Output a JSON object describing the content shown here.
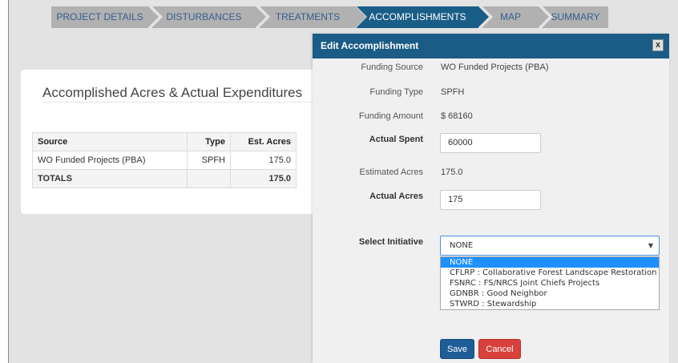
{
  "tabs": [
    {
      "label": "PROJECT DETAILS"
    },
    {
      "label": "DISTURBANCES"
    },
    {
      "label": "TREATMENTS"
    },
    {
      "label": "ACCOMPLISHMENTS"
    },
    {
      "label": "MAP"
    },
    {
      "label": "SUMMARY"
    }
  ],
  "card": {
    "title": "Accomplished Acres & Actual Expenditures",
    "columns": [
      "Source",
      "Type",
      "Est. Acres"
    ],
    "rows": [
      {
        "source": "WO Funded Projects (PBA)",
        "type": "SPFH",
        "est_acres": "175.0"
      }
    ],
    "totals": {
      "label": "TOTALS",
      "est_acres": "175.0"
    }
  },
  "modal": {
    "title": "Edit Accomplishment",
    "close_label": "x",
    "funding_source_label": "Funding Source",
    "funding_source_value": "WO Funded Projects (PBA)",
    "funding_type_label": "Funding Type",
    "funding_type_value": "SPFH",
    "funding_amount_label": "Funding Amount",
    "funding_amount_value": "$ 68160",
    "actual_spent_label": "Actual Spent",
    "actual_spent_value": "60000",
    "estimated_acres_label": "Estimated Acres",
    "estimated_acres_value": "175.0",
    "actual_acres_label": "Actual Acres",
    "actual_acres_value": "175",
    "initiative_label": "Select Initiative",
    "initiative_selected": "NONE",
    "initiative_options": [
      "NONE",
      "CFLRP : Collaborative Forest Landscape Restoration",
      "FSNRC : FS/NRCS Joint Chiefs Projects",
      "GDNBR : Good Neighbor",
      "STWRD : Stewardship"
    ],
    "save_label": "Save",
    "cancel_label": "Cancel"
  },
  "colors": {
    "header_blue": "#1b5c86",
    "tab_gray": "#b1b1b1",
    "active_tab": "#1a5d87",
    "save_blue": "#1f5d96",
    "cancel_red": "#d9413c",
    "selected_option": "#1e90ff"
  }
}
